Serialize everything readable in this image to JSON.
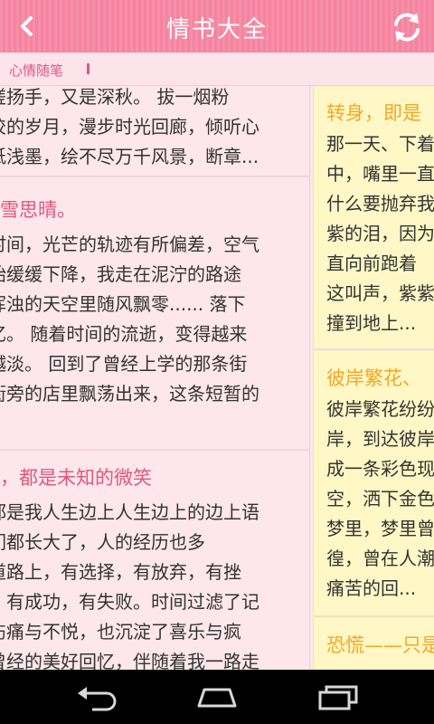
{
  "header": {
    "title": "情书大全"
  },
  "subbar": {
    "label": "心情随笔"
  },
  "left_cards": [
    {
      "title": "",
      "lines": [
        "蹉扬手，又是深秋。 拔一烟粉",
        "皎的岁月，漫步时光回廊，倾听心",
        "纸浅墨，绘不尽万千风景，断章..."
      ]
    },
    {
      "title": "雪思晴。",
      "lines": [
        "时间，光芒的轨迹有所偏差，空气",
        "始缓缓下降，我走在泥泞的路途",
        "浑浊的天空里随风飘零...... 落下",
        "忆。 随着时间的流逝，变得越来",
        "越淡。 回到了曾经上学的那条街",
        "街旁的店里飘荡出来，这条短暂的"
      ]
    },
    {
      "title": "，都是未知的微笑",
      "lines": [
        "都是我人生边上人生边上的边上语",
        "们都长大了，人的经历也多",
        "道路上，有选择，有放弃，有挫",
        "，有成功，有失败。时间过滤了记",
        "伤痛与不悦，也沉淀了喜乐与疯",
        "曾经的美好回忆，伴随着我一路走"
      ]
    }
  ],
  "right_cards": [
    {
      "title": "转身，即是",
      "lines": [
        "那一天、下着",
        "中，嘴里一直",
        "什么要抛弃我",
        "紫的泪，因为",
        "直向前跑着",
        "这叫声，紫紫",
        "撞到地上..."
      ]
    },
    {
      "title": "彼岸繁花、",
      "lines": [
        "彼岸繁花纷纷",
        "岸，到达彼岸",
        "成一条彩色现",
        "空，洒下金色",
        "梦里，梦里曾",
        "徨，曾在人潮",
        "痛苦的回..."
      ]
    },
    {
      "title": "恐慌——只是",
      "lines": []
    }
  ],
  "colors": {
    "header": "#f78fa9",
    "pink_title": "#e1567c",
    "yellow_title": "#f5a623",
    "pink_bg": "#fde7ec",
    "yellow_bg": "#fff8c6"
  },
  "icons": {
    "back": "chevron-left-icon",
    "refresh": "refresh-icon",
    "nav_back": "back-arrow-icon",
    "nav_home": "home-icon",
    "nav_recent": "recent-apps-icon"
  }
}
